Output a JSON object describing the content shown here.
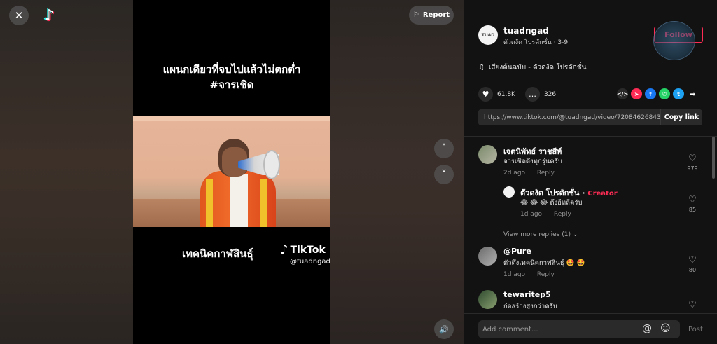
{
  "video": {
    "caption_line1": "แผนกเดียวที่จบไปแล้วไม่ตกต่ำ",
    "caption_line2": "#จารเชิด",
    "bottom_text": "เทคนิคกาฬสินธุ์",
    "watermark": "TikTok",
    "watermark_handle": "@tuadngad"
  },
  "controls": {
    "close_icon": "✕",
    "report_label": "Report",
    "up_icon": "˄",
    "down_icon": "˅",
    "sound_icon": "🔊"
  },
  "author": {
    "username": "tuadngad",
    "subtitle": "ตัวดงัด โปรดักชั่น · 3-9",
    "follow_label": "Follow",
    "avatar_text": "TUAD"
  },
  "music": {
    "icon": "♫",
    "title": "เสียงต้นฉบับ - ตัวดงัด โปรดักชั่น"
  },
  "stats": {
    "likes": "61.8K",
    "comments": "326"
  },
  "share": {
    "link": "https://www.tiktok.com/@tuadngad/video/7208462684394...",
    "copy_label": "Copy link"
  },
  "comments": [
    {
      "name": "เจตนิพัทธ์ ราชสีห์",
      "text": "จารเชิดดึงทุกรุ่นครับ",
      "time": "2d ago",
      "reply": "Reply",
      "likes": "979"
    },
    {
      "name": "ตัวดงัด โปรดักชั่น ·",
      "tag": "Creator",
      "text": "😂 😂 😂  ดึงอีหลีครับ",
      "time": "1d ago",
      "reply": "Reply",
      "likes": "85"
    },
    {
      "name": "@Pure",
      "text": "ตัวดึงเทคนิคกาฬสินธุ์ 🤩 🤩",
      "time": "1d ago",
      "reply": "Reply",
      "likes": "80"
    },
    {
      "name": "tewaritep5",
      "text": "ก่อสร้างสูงกว่าครับ"
    }
  ],
  "more_replies": "View more replies (1) ⌄",
  "footer": {
    "placeholder": "Add comment...",
    "mention_icon": "@",
    "emoji_icon": "☺",
    "post_label": "Post"
  },
  "colors": {
    "accent": "#fe2c55",
    "panel_bg": "#121212"
  }
}
